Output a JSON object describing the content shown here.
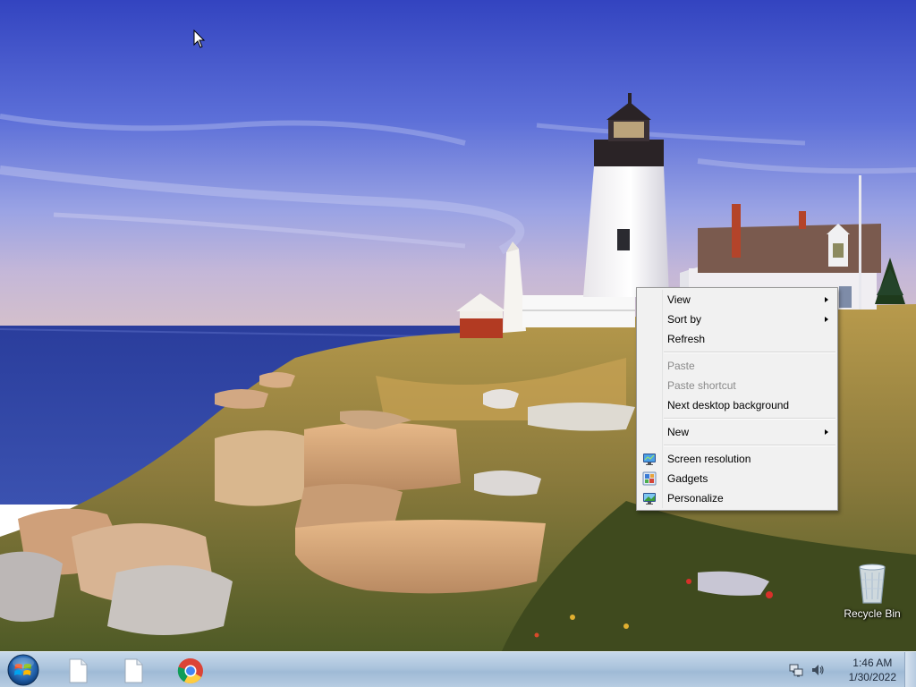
{
  "context_menu": {
    "items": [
      {
        "label": "View",
        "submenu": true,
        "enabled": true
      },
      {
        "label": "Sort by",
        "submenu": true,
        "enabled": true
      },
      {
        "label": "Refresh",
        "submenu": false,
        "enabled": true
      },
      {
        "label": "Paste",
        "submenu": false,
        "enabled": false
      },
      {
        "label": "Paste shortcut",
        "submenu": false,
        "enabled": false
      },
      {
        "label": "Next desktop background",
        "submenu": false,
        "enabled": true
      },
      {
        "label": "New",
        "submenu": true,
        "enabled": true
      },
      {
        "label": "Screen resolution",
        "icon": "monitor-icon",
        "enabled": true
      },
      {
        "label": "Gadgets",
        "icon": "gadgets-icon",
        "enabled": true
      },
      {
        "label": "Personalize",
        "icon": "personalize-icon",
        "enabled": true
      }
    ]
  },
  "desktop_icons": {
    "recycle_bin": {
      "label": "Recycle Bin",
      "icon": "recycle-bin-icon"
    }
  },
  "taskbar": {
    "start_icon": "windows-logo-icon",
    "pinned": [
      {
        "icon": "document-icon"
      },
      {
        "icon": "document-icon"
      },
      {
        "icon": "chrome-icon"
      }
    ],
    "tray": {
      "network_icon": "network-icon",
      "volume_icon": "speaker-icon",
      "time": "1:46 AM",
      "date": "1/30/2022"
    }
  },
  "colors": {
    "sky_top": "#3a4fc8",
    "sea": "#2f45a0",
    "taskbar": "#aac3dc"
  }
}
